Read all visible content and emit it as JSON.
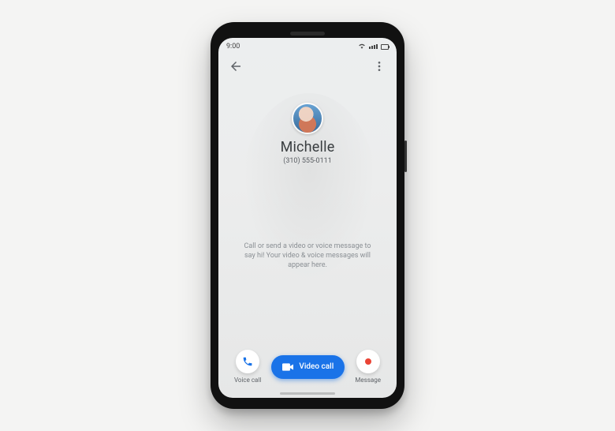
{
  "status": {
    "time": "9:00"
  },
  "contact": {
    "name": "Michelle",
    "phone": "(310) 555-0111",
    "hint": "Call or send a video or voice message to say hi! Your video & voice messages will appear here."
  },
  "actions": {
    "voice_label": "Voice call",
    "video_label": "Video call",
    "message_label": "Message"
  }
}
